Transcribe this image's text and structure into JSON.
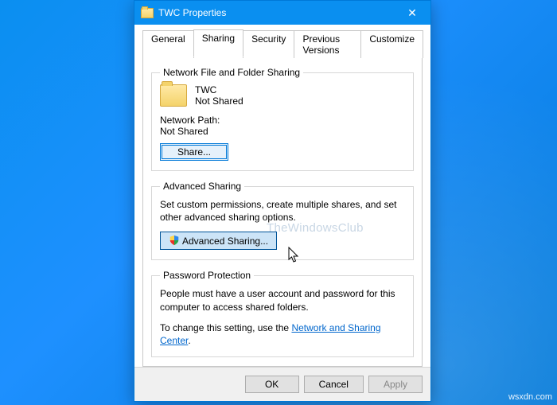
{
  "window": {
    "title": "TWC Properties",
    "tabs": [
      "General",
      "Sharing",
      "Security",
      "Previous Versions",
      "Customize"
    ],
    "active_tab": 1
  },
  "section_nfs": {
    "legend": "Network File and Folder Sharing",
    "item_name": "TWC",
    "item_status": "Not Shared",
    "path_label": "Network Path:",
    "path_value": "Not Shared",
    "share_btn": "Share..."
  },
  "section_adv": {
    "legend": "Advanced Sharing",
    "desc": "Set custom permissions, create multiple shares, and set other advanced sharing options.",
    "btn": "Advanced Sharing..."
  },
  "section_pwd": {
    "legend": "Password Protection",
    "line1": "People must have a user account and password for this computer to access shared folders.",
    "line2_pre": "To change this setting, use the ",
    "link": "Network and Sharing Center",
    "line2_post": "."
  },
  "footer": {
    "ok": "OK",
    "cancel": "Cancel",
    "apply": "Apply"
  },
  "watermark": "TheWindowsClub",
  "corner": "wsxdn.com"
}
